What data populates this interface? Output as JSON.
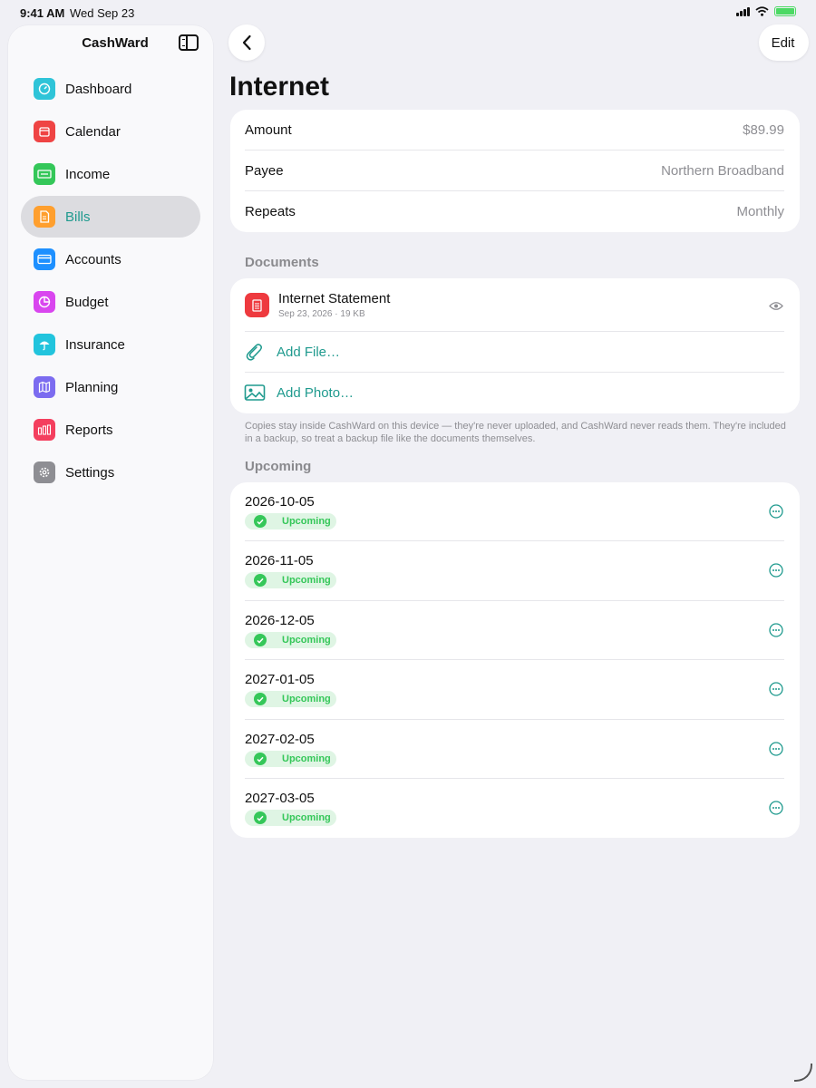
{
  "status_bar": {
    "time": "9:41 AM",
    "date": "Wed Sep 23"
  },
  "sidebar": {
    "title": "CashWard",
    "items": [
      {
        "label": "Dashboard",
        "icon": "gauge-icon",
        "color": "#2fc4d8"
      },
      {
        "label": "Calendar",
        "icon": "calendar-icon",
        "color": "#ef4444"
      },
      {
        "label": "Income",
        "icon": "banknote-icon",
        "color": "#34c759"
      },
      {
        "label": "Bills",
        "icon": "document-icon",
        "color": "#ff9f2e",
        "active": true
      },
      {
        "label": "Accounts",
        "icon": "credit-card-icon",
        "color": "#1e90ff"
      },
      {
        "label": "Budget",
        "icon": "pie-chart-icon",
        "color": "#d946ef"
      },
      {
        "label": "Insurance",
        "icon": "umbrella-icon",
        "color": "#22c4dd"
      },
      {
        "label": "Planning",
        "icon": "map-icon",
        "color": "#7c6cf0"
      },
      {
        "label": "Reports",
        "icon": "bar-chart-icon",
        "color": "#f43f5e"
      },
      {
        "label": "Settings",
        "icon": "gear-icon",
        "color": "#8e8e93"
      }
    ]
  },
  "toolbar": {
    "edit_label": "Edit"
  },
  "page": {
    "title": "Internet"
  },
  "details": [
    {
      "label": "Amount",
      "value": "$89.99"
    },
    {
      "label": "Payee",
      "value": "Northern Broadband"
    },
    {
      "label": "Repeats",
      "value": "Monthly"
    }
  ],
  "documents": {
    "section_label": "Documents",
    "file": {
      "name": "Internet Statement",
      "meta": "Sep 23, 2026 · 19 KB"
    },
    "add_file_label": "Add File…",
    "add_photo_label": "Add Photo…",
    "footnote": "Copies stay inside CashWard on this device — they're never uploaded, and CashWard never reads them. They're included in a backup, so treat a backup file like the documents themselves."
  },
  "upcoming": {
    "section_label": "Upcoming",
    "items": [
      {
        "date": "2026-10-05",
        "status": "Upcoming"
      },
      {
        "date": "2026-11-05",
        "status": "Upcoming"
      },
      {
        "date": "2026-12-05",
        "status": "Upcoming"
      },
      {
        "date": "2027-01-05",
        "status": "Upcoming"
      },
      {
        "date": "2027-02-05",
        "status": "Upcoming"
      },
      {
        "date": "2027-03-05",
        "status": "Upcoming"
      }
    ]
  },
  "colors": {
    "accent": "#1f9a8e",
    "status_green": "#35c759",
    "background": "#f0f0f5"
  }
}
